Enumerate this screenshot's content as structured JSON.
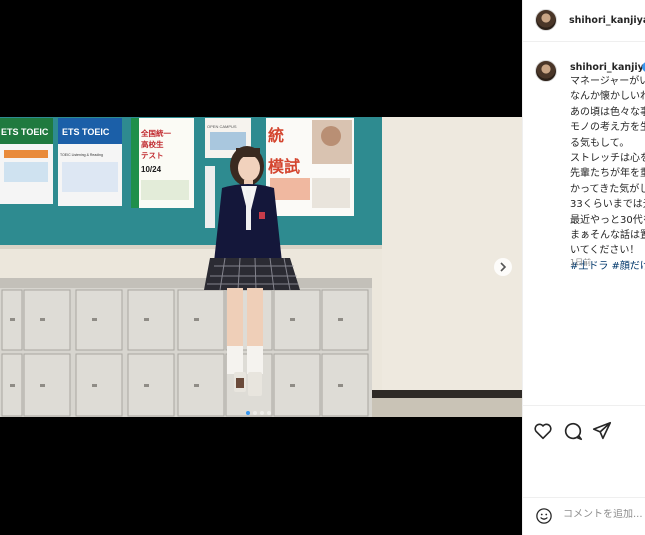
{
  "post": {
    "username": "shihori_kanjiya",
    "caption_lines": [
      "マネージャーがい",
      "なんか懐かしいわ",
      "あの頃は色々な事",
      "モノの考え方を生",
      "る気もして。",
      "ストレッチは心を",
      "先輩たちが年を重",
      "かってきた気がし",
      "33くらいまでは元",
      "最近やっと30代を",
      "まぁそんな話は置",
      "いてください！"
    ],
    "hashtags": "#土ドラ #顔だけ",
    "time": "1日前"
  },
  "photo": {
    "posters": {
      "toeic1": "ETS TOEIC",
      "toeic2": "ETS TOEIC",
      "toeic2_sub": "TOEIC Listening & Reading",
      "test_title": "全国統一高校生テスト",
      "test_date": "10/24",
      "open_campus": "OPEN CAMPUS",
      "mock_exam": "統一模試"
    },
    "slide_count": 4,
    "active_slide": 1
  },
  "comment": {
    "placeholder": "コメントを追加..."
  },
  "colors": {
    "link": "#00376b",
    "active_dot": "#3897f0"
  },
  "icons": {
    "like": "heart-icon",
    "comment": "comment-icon",
    "share": "share-icon",
    "emoji": "emoji-icon",
    "next": "chevron-right-icon",
    "verified": "verified-badge-icon"
  }
}
